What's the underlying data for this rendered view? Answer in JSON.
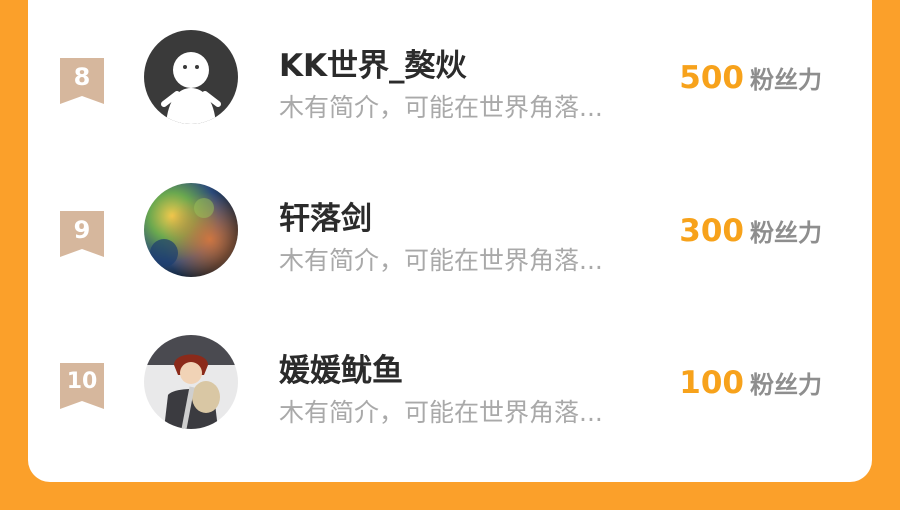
{
  "ranking": [
    {
      "rank": "8",
      "name": "KK世界_獒炏",
      "bio": "木有简介，可能在世界角落...",
      "fans_value": "500",
      "fans_label": "粉丝力",
      "avatar": "default-person-avatar"
    },
    {
      "rank": "9",
      "name": "轩落剑",
      "bio": "木有简介，可能在世界角落...",
      "fans_value": "300",
      "fans_label": "粉丝力",
      "avatar": "nebula-avatar"
    },
    {
      "rank": "10",
      "name": "媛媛鱿鱼",
      "bio": "木有简介，可能在世界角落...",
      "fans_value": "100",
      "fans_label": "粉丝力",
      "avatar": "anime-character-avatar"
    }
  ],
  "colors": {
    "background": "#fba02a",
    "fans_number": "#f7a21b",
    "rank_ribbon": "#d6b79d"
  }
}
